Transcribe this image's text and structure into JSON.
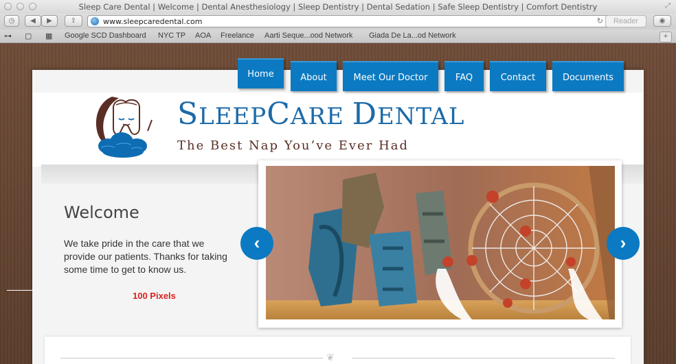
{
  "browser": {
    "window_title": "Sleep Care Dental | Welcome | Dental Anesthesiology | Sleep Dentistry | Dental Sedation | Safe Sleep Dentistry | Comfort Dentistry",
    "url": "www.sleepcaredental.com",
    "reader_label": "Reader",
    "bookmarks": [
      "Google SCD Dashboard",
      "NYC TP",
      "AOA",
      "Freelance",
      "Aarti Seque...ood Network",
      "Giada De La...od Network"
    ]
  },
  "nav": {
    "items": [
      "Home",
      "About",
      "Meet Our Doctor",
      "FAQ",
      "Contact",
      "Documents"
    ]
  },
  "brand": {
    "title_parts": [
      "S",
      "LEEP",
      "C",
      "ARE ",
      "D",
      "ENTAL"
    ],
    "tagline": "The Best Nap You’ve Ever Had"
  },
  "welcome": {
    "title": "Welcome",
    "body": "We take pride in the care that we provide our patients.  Thanks for taking some time to get to know us.",
    "annotation": "100 Pixels"
  },
  "slider": {
    "prev_label": "‹",
    "next_label": "›"
  },
  "colors": {
    "accent": "#0b7ac2",
    "brand_blue": "#1c6aa8",
    "tagline_brown": "#5a2e24",
    "annotation_red": "#d82020"
  }
}
